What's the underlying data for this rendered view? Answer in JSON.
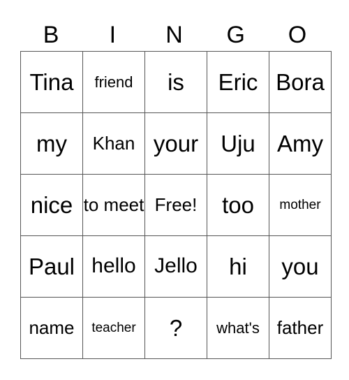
{
  "header": [
    "B",
    "I",
    "N",
    "G",
    "O"
  ],
  "rows": [
    [
      "Tina",
      "friend",
      "is",
      "Eric",
      "Bora"
    ],
    [
      "my",
      "Khan",
      "your",
      "Uju",
      "Amy"
    ],
    [
      "nice",
      "to meet",
      "Free!",
      "too",
      "mother"
    ],
    [
      "Paul",
      "hello",
      "Jello",
      "hi",
      "you"
    ],
    [
      "name",
      "teacher",
      "?",
      "what's",
      "father"
    ]
  ]
}
